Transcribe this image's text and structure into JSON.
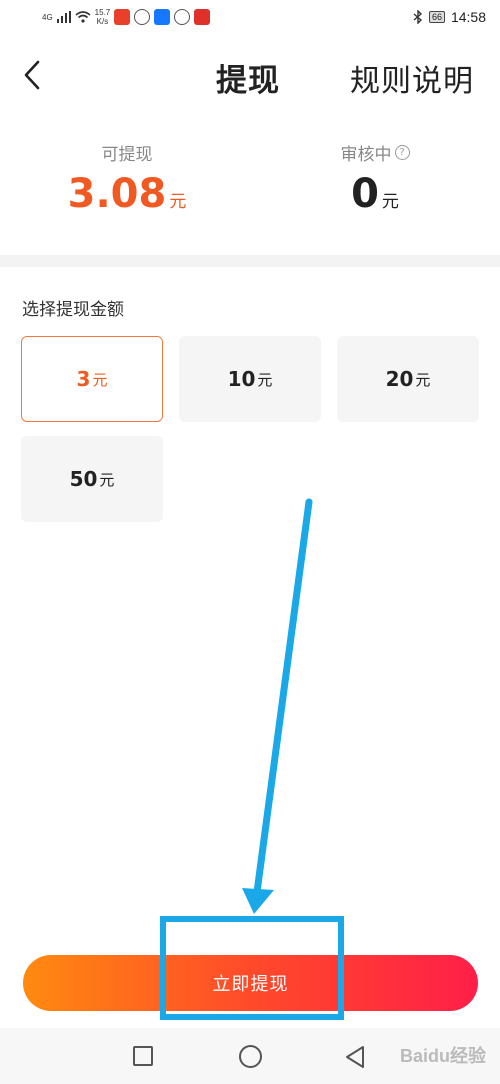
{
  "status_bar": {
    "network_type": "4G",
    "speed": "15.7",
    "speed_unit": "K/s",
    "battery": "66",
    "time": "14:58"
  },
  "header": {
    "title": "提现",
    "rules_label": "规则说明"
  },
  "balance": {
    "available_label": "可提现",
    "available_value": "3.08",
    "available_unit": "元",
    "review_label": "审核中",
    "review_value": "0",
    "review_unit": "元"
  },
  "amount_section": {
    "title": "选择提现金额",
    "options": [
      {
        "value": "3",
        "unit": "元"
      },
      {
        "value": "10",
        "unit": "元"
      },
      {
        "value": "20",
        "unit": "元"
      },
      {
        "value": "50",
        "unit": "元"
      }
    ],
    "selected_index": 0
  },
  "withdraw_button": {
    "label": "立即提现"
  },
  "watermark": "Baidu经验",
  "colors": {
    "accent": "#f05a22",
    "annotation": "#1aa8e8"
  }
}
